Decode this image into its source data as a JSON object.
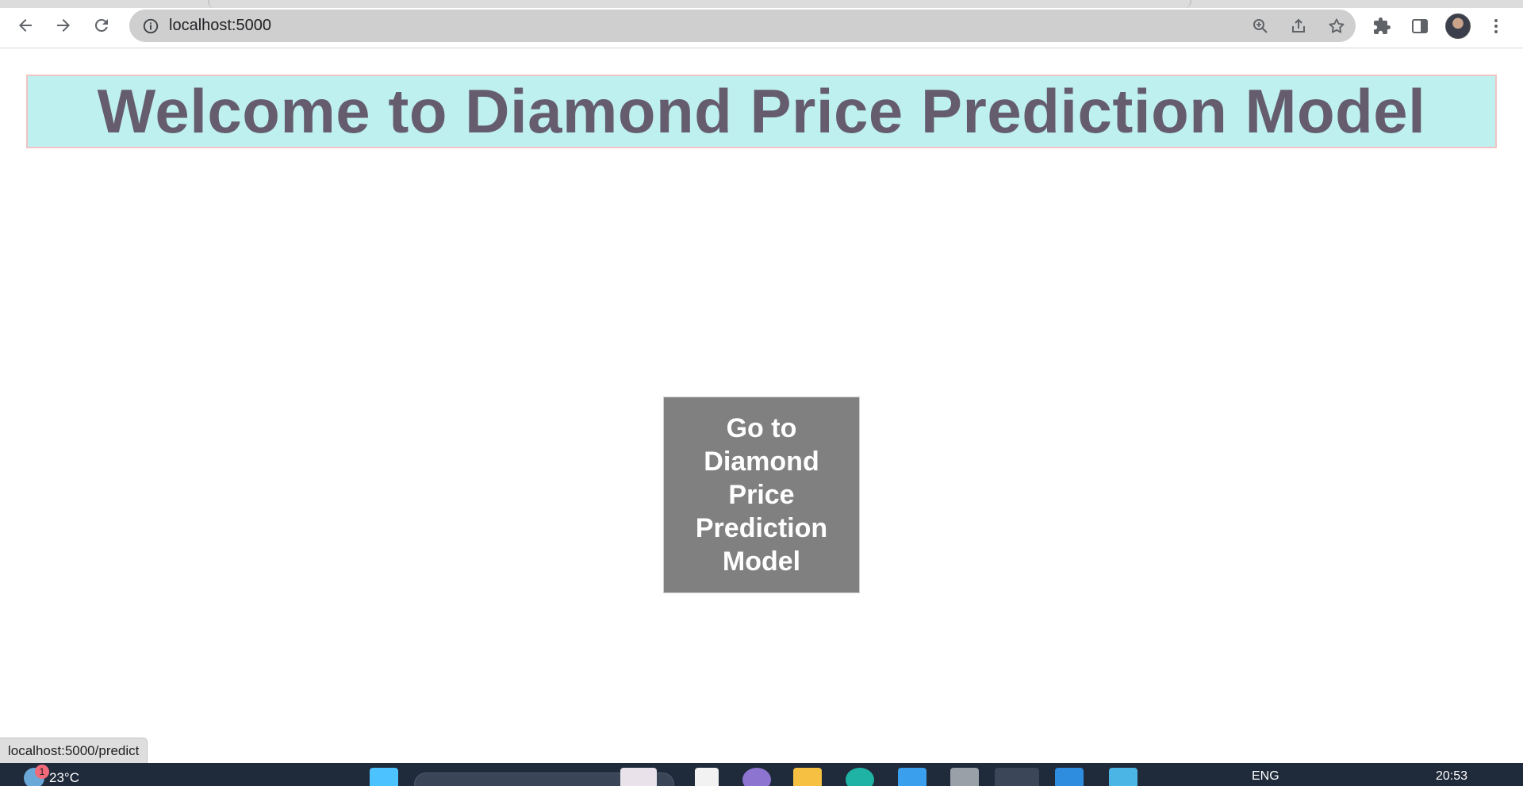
{
  "browser": {
    "url": "localhost:5000"
  },
  "page": {
    "heading": "Welcome to Diamond Price Prediction Model",
    "button_label": "Go to Diamond Price Prediction Model"
  },
  "status_bar": {
    "link_preview": "localhost:5000/predict"
  },
  "taskbar": {
    "temperature": "23°C",
    "notification_count": "1",
    "language": "ENG",
    "time": "20:53"
  },
  "colors": {
    "banner_bg": "#bff0f0",
    "banner_border": "#f2c4c4",
    "heading_text": "#655d6e",
    "button_bg": "#808080",
    "button_text": "#ffffff"
  }
}
